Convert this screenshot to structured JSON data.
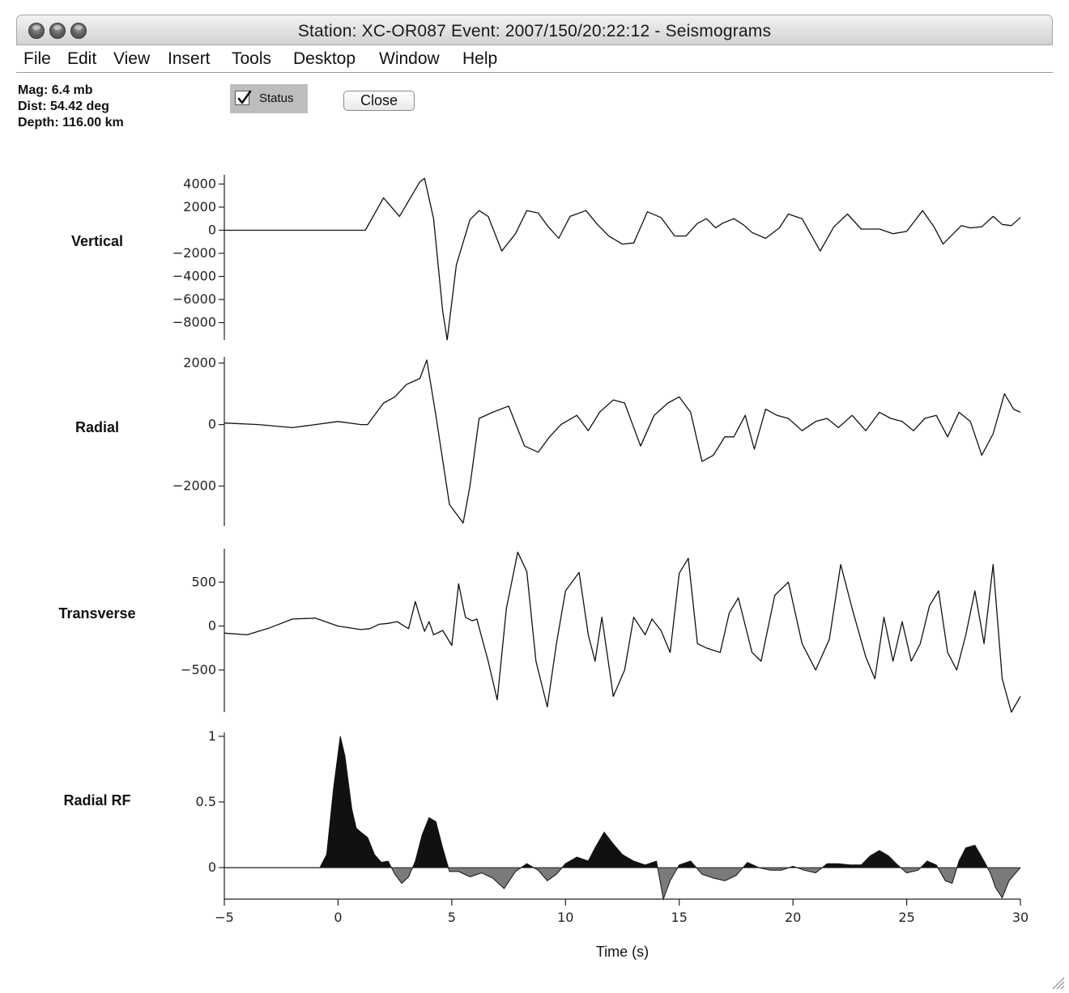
{
  "window": {
    "title": "Station: XC-OR087 Event: 2007/150/20:22:12 - Seismograms"
  },
  "menu": [
    "File",
    "Edit",
    "View",
    "Insert",
    "Tools",
    "Desktop",
    "Window",
    "Help"
  ],
  "event_info": {
    "mag": "Mag: 6.4 mb",
    "dist": "Dist: 54.42 deg",
    "depth": "Depth: 116.00 km"
  },
  "controls": {
    "status_label": "Status",
    "status_checked": true,
    "close_label": "Close"
  },
  "chart_data": [
    {
      "type": "line",
      "name": "Vertical",
      "ylim": [
        -9500,
        4800
      ],
      "yticks": [
        4000,
        2000,
        0,
        -2000,
        -4000,
        -6000,
        -8000
      ],
      "ytick_labels": [
        "4000",
        "2000",
        "0",
        "−2000",
        "−4000",
        "−6000",
        "−8000"
      ],
      "xlim": [
        -5,
        30
      ],
      "x": [
        -5,
        1.2,
        2.0,
        2.7,
        3.3,
        3.6,
        3.8,
        4.2,
        4.6,
        4.8,
        5.2,
        5.8,
        6.2,
        6.6,
        7.2,
        7.8,
        8.3,
        8.8,
        9.2,
        9.7,
        10.2,
        10.9,
        11.4,
        11.9,
        12.5,
        13.0,
        13.6,
        14.2,
        14.8,
        15.3,
        15.8,
        16.2,
        16.6,
        16.9,
        17.4,
        17.8,
        18.2,
        18.8,
        19.4,
        19.8,
        20.4,
        21.2,
        21.8,
        22.4,
        23.0,
        23.8,
        24.4,
        25.0,
        25.7,
        26.2,
        26.6,
        27.0,
        27.4,
        27.8,
        28.3,
        28.8,
        29.2,
        29.6,
        30
      ],
      "y": [
        0,
        0,
        2800,
        1200,
        3200,
        4200,
        4500,
        1000,
        -7000,
        -9500,
        -3000,
        900,
        1700,
        1200,
        -1800,
        -300,
        1700,
        1500,
        400,
        -700,
        1200,
        1700,
        500,
        -500,
        -1200,
        -1100,
        1600,
        1100,
        -500,
        -500,
        600,
        1000,
        200,
        600,
        1000,
        500,
        -200,
        -700,
        200,
        1400,
        1000,
        -1800,
        300,
        1400,
        100,
        100,
        -300,
        -100,
        1700,
        300,
        -1200,
        -400,
        400,
        200,
        300,
        1200,
        500,
        400,
        1100
      ],
      "series_name": "Vertical"
    },
    {
      "type": "line",
      "name": "Radial",
      "ylim": [
        -3300,
        2200
      ],
      "yticks": [
        2000,
        0,
        -2000
      ],
      "ytick_labels": [
        "2000",
        "0",
        "−2000"
      ],
      "xlim": [
        -5,
        30
      ],
      "x": [
        -5,
        -3.5,
        -2,
        -1,
        0,
        1,
        1.3,
        2.0,
        2.5,
        3.0,
        3.6,
        3.9,
        4.3,
        4.9,
        5.5,
        5.8,
        6.2,
        6.8,
        7.5,
        8.2,
        8.8,
        9.3,
        9.8,
        10.5,
        11.0,
        11.5,
        12.1,
        12.6,
        13.3,
        13.9,
        14.5,
        15.0,
        15.5,
        16.0,
        16.5,
        17.0,
        17.4,
        17.9,
        18.3,
        18.8,
        19.3,
        19.8,
        20.4,
        21.0,
        21.5,
        22.0,
        22.6,
        23.2,
        23.8,
        24.3,
        24.8,
        25.3,
        25.8,
        26.3,
        26.8,
        27.3,
        27.8,
        28.3,
        28.8,
        29.3,
        29.7,
        30
      ],
      "y": [
        50,
        0,
        -100,
        0,
        100,
        0,
        0,
        700,
        900,
        1300,
        1500,
        2100,
        300,
        -2600,
        -3200,
        -2000,
        200,
        400,
        600,
        -700,
        -900,
        -400,
        0,
        300,
        -200,
        400,
        800,
        700,
        -700,
        300,
        700,
        900,
        400,
        -1200,
        -1000,
        -400,
        -400,
        300,
        -800,
        500,
        300,
        200,
        -200,
        100,
        200,
        -100,
        300,
        -200,
        400,
        200,
        100,
        -200,
        200,
        300,
        -400,
        400,
        100,
        -1000,
        -300,
        1000,
        500,
        400
      ],
      "series_name": "Radial"
    },
    {
      "type": "line",
      "name": "Transverse",
      "ylim": [
        -980,
        880
      ],
      "yticks": [
        500,
        0,
        -500
      ],
      "ytick_labels": [
        "500",
        "0",
        "−500"
      ],
      "xlim": [
        -5,
        30
      ],
      "x": [
        -5,
        -4,
        -3,
        -2,
        -1,
        0,
        1,
        1.4,
        1.8,
        2.2,
        2.6,
        2.9,
        3.1,
        3.4,
        3.6,
        3.8,
        4.0,
        4.2,
        4.6,
        5.0,
        5.3,
        5.6,
        5.9,
        6.1,
        6.6,
        7.0,
        7.4,
        7.9,
        8.3,
        8.7,
        9.2,
        9.6,
        10.0,
        10.6,
        11.0,
        11.3,
        11.6,
        12.1,
        12.6,
        13.0,
        13.5,
        13.8,
        14.2,
        14.6,
        15.0,
        15.4,
        15.8,
        16.2,
        16.8,
        17.2,
        17.6,
        18.2,
        18.6,
        19.2,
        19.8,
        20.4,
        21.0,
        21.6,
        22.1,
        22.6,
        23.2,
        23.6,
        24.0,
        24.4,
        24.8,
        25.2,
        25.6,
        26.0,
        26.4,
        26.8,
        27.2,
        27.6,
        28.0,
        28.4,
        28.8,
        29.2,
        29.6,
        30
      ],
      "y": [
        -80,
        -100,
        -20,
        80,
        90,
        0,
        -40,
        -30,
        20,
        30,
        50,
        0,
        -30,
        280,
        100,
        -60,
        50,
        -100,
        -50,
        -220,
        480,
        100,
        60,
        80,
        -400,
        -840,
        200,
        840,
        620,
        -400,
        -920,
        -200,
        400,
        610,
        -100,
        -400,
        100,
        -800,
        -500,
        100,
        -100,
        80,
        -50,
        -300,
        600,
        770,
        -200,
        -250,
        -300,
        150,
        320,
        -300,
        -400,
        350,
        500,
        -200,
        -500,
        -150,
        700,
        200,
        -350,
        -600,
        100,
        -400,
        50,
        -400,
        -200,
        230,
        400,
        -300,
        -500,
        -100,
        400,
        -200,
        700,
        -600,
        -980,
        -800
      ],
      "series_name": "Transverse"
    },
    {
      "type": "area",
      "name": "Radial RF",
      "ylim": [
        -0.24,
        1.03
      ],
      "yticks": [
        1,
        0.5,
        0
      ],
      "ytick_labels": [
        "1",
        "0.5",
        "0"
      ],
      "xlim": [
        -5,
        30
      ],
      "xticks": [
        -5,
        0,
        5,
        10,
        15,
        20,
        25,
        30
      ],
      "xtick_labels": [
        "−5",
        "0",
        "5",
        "10",
        "15",
        "20",
        "25",
        "30"
      ],
      "xlabel": "Time (s)",
      "x": [
        -5,
        -0.8,
        -0.5,
        -0.2,
        0.1,
        0.3,
        0.6,
        0.8,
        1.0,
        1.3,
        1.6,
        1.9,
        2.2,
        2.5,
        2.8,
        3.1,
        3.4,
        3.7,
        4.0,
        4.3,
        4.6,
        4.9,
        5.3,
        5.8,
        6.3,
        6.8,
        7.3,
        7.8,
        8.3,
        8.8,
        9.2,
        9.6,
        10.0,
        10.5,
        11.0,
        11.3,
        11.7,
        12.1,
        12.5,
        13.0,
        13.5,
        14.0,
        14.3,
        14.6,
        15.0,
        15.5,
        16.0,
        16.5,
        17.0,
        17.5,
        18.0,
        18.5,
        19.0,
        19.5,
        20.0,
        20.5,
        21.0,
        21.5,
        22.0,
        22.5,
        23.0,
        23.4,
        23.8,
        24.2,
        24.6,
        25.0,
        25.5,
        25.9,
        26.3,
        26.7,
        27.0,
        27.3,
        27.6,
        28.0,
        28.4,
        28.7,
        28.9,
        29.2,
        29.5,
        30
      ],
      "y": [
        0,
        0,
        0.1,
        0.6,
        1.0,
        0.85,
        0.45,
        0.3,
        0.27,
        0.23,
        0.1,
        0.04,
        0.05,
        -0.05,
        -0.12,
        -0.07,
        0.05,
        0.25,
        0.38,
        0.35,
        0.15,
        -0.03,
        -0.03,
        -0.07,
        -0.04,
        -0.08,
        -0.16,
        -0.03,
        0.03,
        -0.02,
        -0.1,
        -0.05,
        0.03,
        0.08,
        0.05,
        0.15,
        0.27,
        0.18,
        0.1,
        0.05,
        0.02,
        0.05,
        -0.24,
        -0.1,
        0.02,
        0.05,
        -0.05,
        -0.08,
        -0.1,
        -0.06,
        0.04,
        0.0,
        -0.02,
        -0.02,
        0.01,
        -0.02,
        -0.04,
        0.03,
        0.03,
        0.02,
        0.02,
        0.09,
        0.13,
        0.09,
        0.02,
        -0.04,
        -0.02,
        0.05,
        0.02,
        -0.1,
        -0.12,
        0.05,
        0.15,
        0.17,
        0.05,
        -0.05,
        -0.15,
        -0.23,
        -0.1,
        0
      ],
      "series_name": "Radial RF"
    }
  ]
}
